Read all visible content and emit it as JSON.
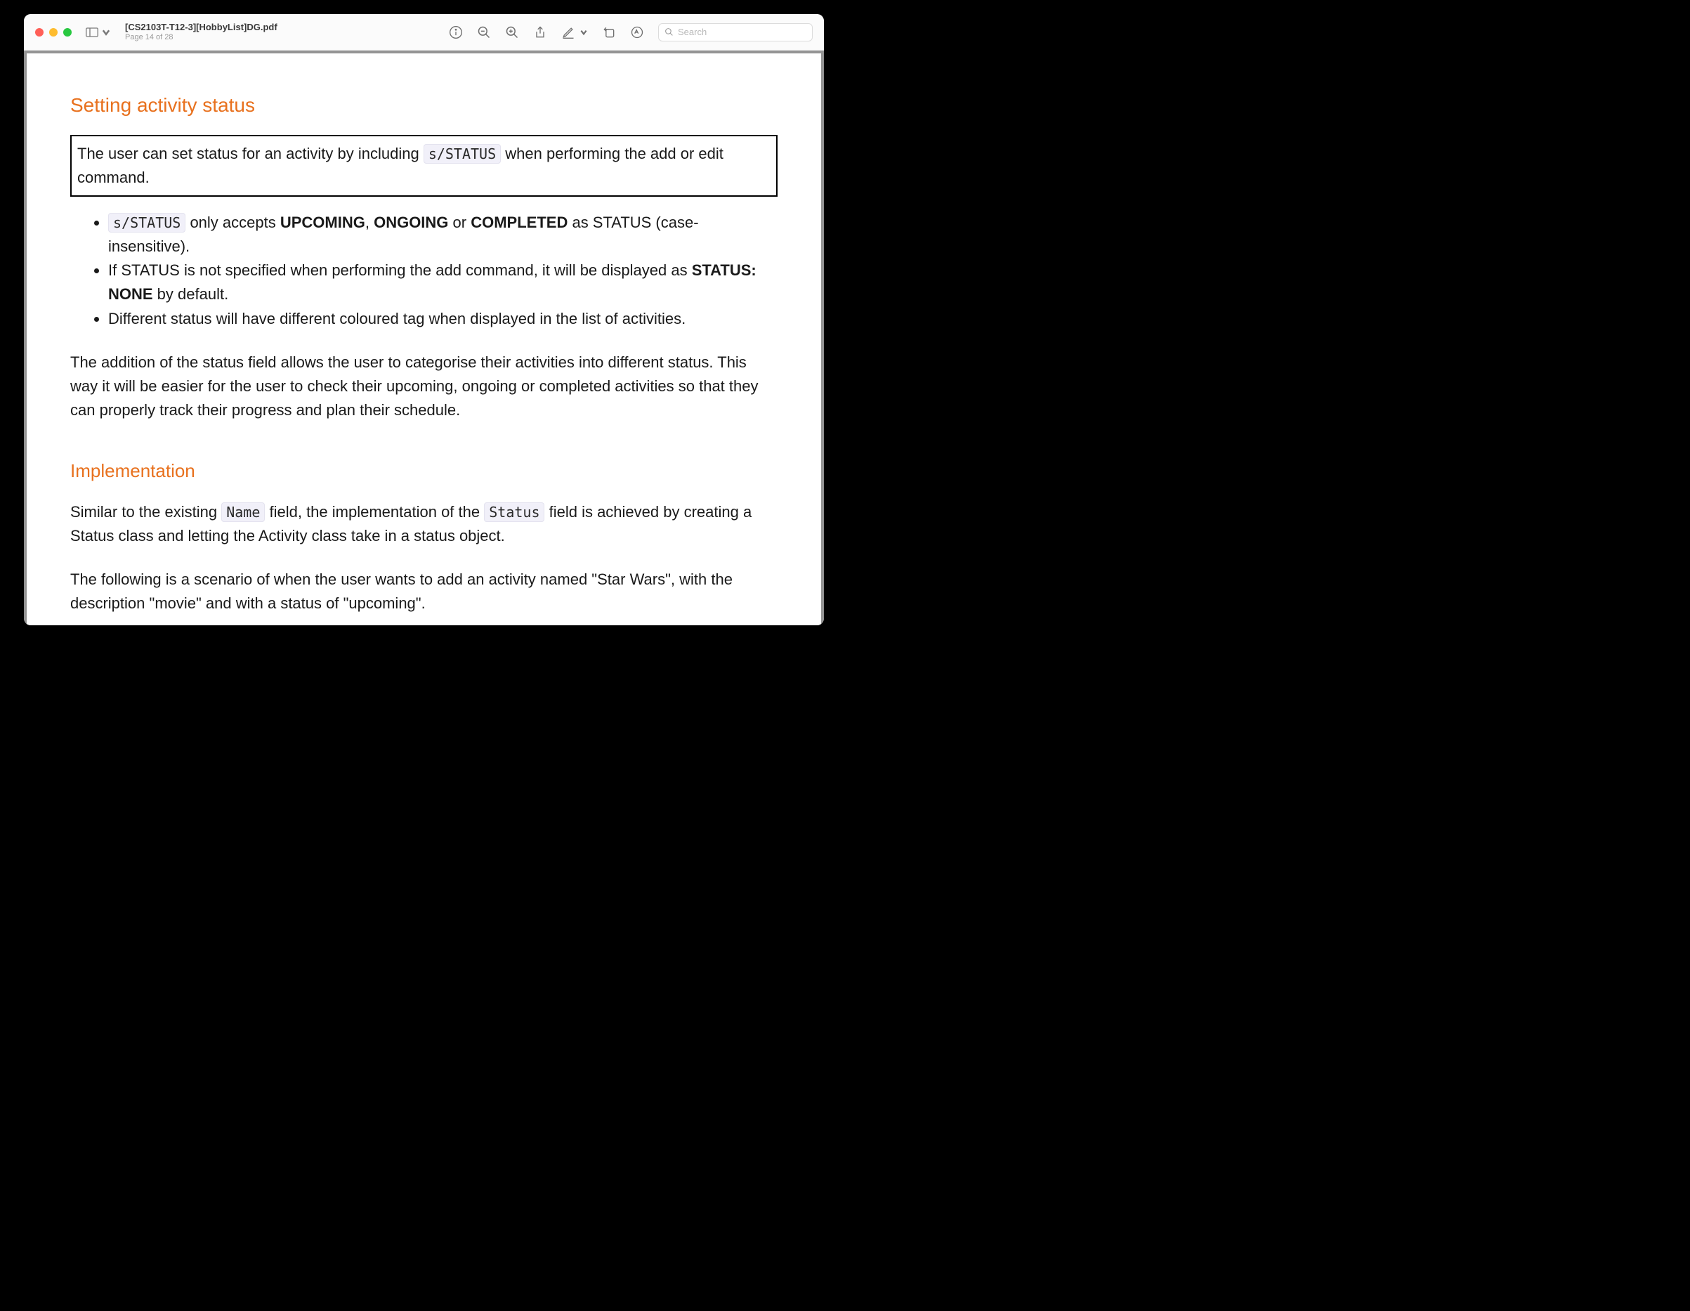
{
  "window": {
    "doc_title": "[CS2103T-T12-3][HobbyList]DG.pdf",
    "page_indicator": "Page 14 of 28",
    "search_placeholder": "Search"
  },
  "doc": {
    "h_setting": "Setting activity status",
    "boxed_p1a": "The user can set status for an activity by including ",
    "boxed_code": "s/STATUS",
    "boxed_p1b": " when performing the add or edit command.",
    "li1_code": "s/STATUS",
    "li1_a": " only accepts ",
    "li1_b1": "UPCOMING",
    "li1_c": ", ",
    "li1_b2": "ONGOING",
    "li1_d": " or ",
    "li1_b3": "COMPLETED",
    "li1_e": " as STATUS (case-insensitive).",
    "li2_a": "If STATUS is not specified when performing the add command, it will be displayed as ",
    "li2_b": "STATUS: NONE",
    "li2_c": " by default.",
    "li3": "Different status will have different coloured tag when displayed in the list of activities.",
    "para2": "The addition of the status field allows the user to categorise their activities into different status. This way it will be easier for the user to check their upcoming, ongoing or completed activities so that they can properly track their progress and plan their schedule.",
    "h_impl": "Implementation",
    "impl_p1a": "Similar to the existing ",
    "impl_code1": "Name",
    "impl_p1b": " field, the implementation of the ",
    "impl_code2": "Status",
    "impl_p1c": " field is achieved by creating a Status class and letting the Activity class take in a status object.",
    "impl_p2": "The following is a scenario of when the user wants to add an activity named \"Star Wars\", with the description \"movie\" and with a status of \"upcoming\"."
  }
}
